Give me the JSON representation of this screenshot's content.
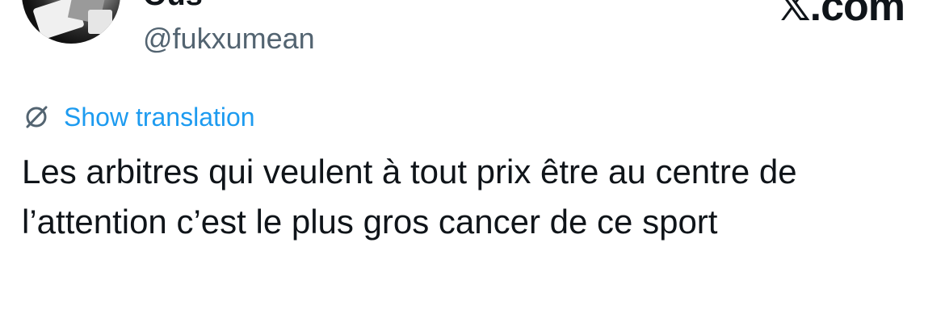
{
  "author": {
    "display_name": "Ous",
    "handle": "@fukxumean"
  },
  "brand": {
    "logo_text": "𝕏.com"
  },
  "translation": {
    "label": "Show translation",
    "icon": "no-translate-icon"
  },
  "tweet": {
    "text_lines": [
      "Les arbitres qui veulent à tout prix être au centre de",
      "l’attention c’est le plus gros cancer de ce sport"
    ]
  },
  "colors": {
    "link": "#1d9bf0",
    "secondary_text": "#536471",
    "primary_text": "#0f1419"
  }
}
